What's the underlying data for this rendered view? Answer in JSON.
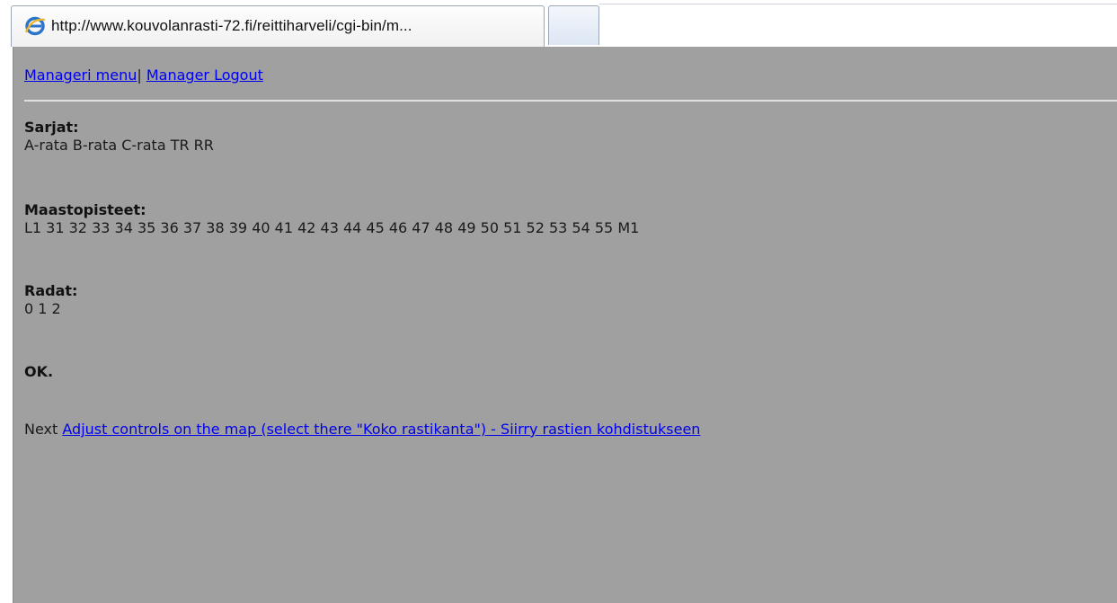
{
  "browser": {
    "tab_title": "http://www.kouvolanrasti-72.fi/reittiharveli/cgi-bin/m..."
  },
  "nav": {
    "manageri_menu": "Manageri menu",
    "separator": "|",
    "manager_logout": "Manager Logout"
  },
  "sections": {
    "sarjat": {
      "label": "Sarjat:",
      "values": "A-rata B-rata C-rata TR RR"
    },
    "maastopisteet": {
      "label": "Maastopisteet:",
      "values": "L1 31 32 33 34 35 36 37 38 39 40 41 42 43 44 45 46 47 48 49 50 51 52 53 54 55 M1"
    },
    "radat": {
      "label": "Radat:",
      "values": "0 1 2"
    }
  },
  "status": "OK.",
  "next": {
    "prefix": "Next",
    "link": "Adjust controls on the map (select there \"Koko rastikanta\") - Siirry rastien kohdistukseen"
  },
  "colors": {
    "page_background": "#a0a0a0",
    "link": "#0000ee",
    "text": "#1a1a1a"
  },
  "icons": {
    "tab_favicon": "internet-explorer-icon"
  }
}
